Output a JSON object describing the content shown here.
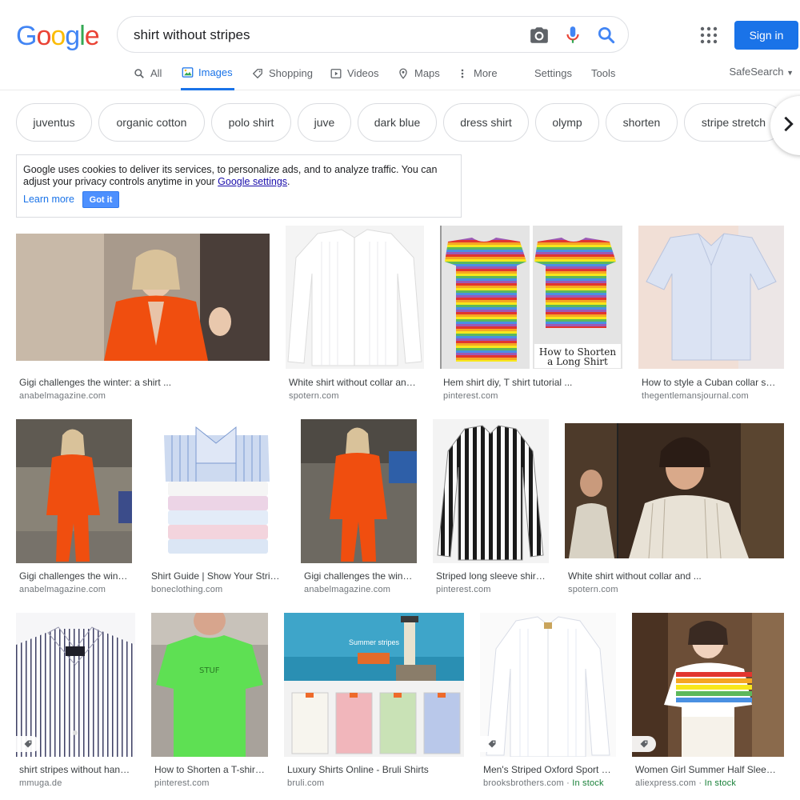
{
  "header": {
    "logo_letters": [
      "G",
      "o",
      "o",
      "g",
      "l",
      "e"
    ],
    "logo_colors": [
      "#4285F4",
      "#EA4335",
      "#FBBC05",
      "#4285F4",
      "#34A853",
      "#EA4335"
    ],
    "search_query": "shirt without stripes",
    "signin_label": "Sign in"
  },
  "tabs": [
    {
      "label": "All",
      "icon": "search-icon"
    },
    {
      "label": "Images",
      "icon": "image-icon",
      "active": true
    },
    {
      "label": "Shopping",
      "icon": "tag-icon"
    },
    {
      "label": "Videos",
      "icon": "play-icon"
    },
    {
      "label": "Maps",
      "icon": "pin-icon"
    },
    {
      "label": "More",
      "icon": "more-vert-icon"
    },
    {
      "label": "Settings"
    },
    {
      "label": "Tools"
    }
  ],
  "safesearch_label": "SafeSearch",
  "chips": [
    "juventus",
    "organic cotton",
    "polo shirt",
    "juve",
    "dark blue",
    "dress shirt",
    "olymp",
    "shorten",
    "stripe stretch"
  ],
  "cookie": {
    "text_before": "Google uses cookies to deliver its services, to personalize ads, and to analyze traffic. You can adjust your privacy controls anytime in your ",
    "link": "Google settings",
    "text_after": ".",
    "learn_more": "Learn more",
    "got_it": "Got it"
  },
  "results": [
    {
      "caption": "Gigi challenges the winter: a shirt ...",
      "source": "anabelmagazine.com"
    },
    {
      "caption": "White shirt without collar and ...",
      "source": "spotern.com"
    },
    {
      "caption": "Hem shirt diy, T shirt tutorial ...",
      "source": "pinterest.com",
      "overlay_line1": "How to Shorten",
      "overlay_line2": "a Long Shirt"
    },
    {
      "caption": "How to style a Cuban collar shirt ...",
      "source": "thegentlemansjournal.com"
    },
    {
      "caption": "Gigi challenges the winter ...",
      "source": "anabelmagazine.com"
    },
    {
      "caption": "Shirt Guide | Show Your Stripes ...",
      "source": "boneclothing.com"
    },
    {
      "caption": "Gigi challenges the winter ...",
      "source": "anabelmagazine.com"
    },
    {
      "caption": "Striped long sleeve shirt ...",
      "source": "pinterest.com"
    },
    {
      "caption": "White shirt without collar and ...",
      "source": "spotern.com"
    },
    {
      "caption": "shirt stripes without hanger ...",
      "source": "mmuga.de"
    },
    {
      "caption": "How to Shorten a T-shirt ...",
      "source": "pinterest.com"
    },
    {
      "caption": "Luxury Shirts Online - Bruli Shirts",
      "source": "bruli.com",
      "overlay_line1": "Summer stripes"
    },
    {
      "caption": "Men's Striped Oxford Sport Shirt ...",
      "source": "brooksbrothers.com",
      "stock": "In stock"
    },
    {
      "caption": "Women Girl Summer Half Sleeve ...",
      "source": "aliexpress.com",
      "stock": "In stock"
    }
  ],
  "stock_separator": " · "
}
